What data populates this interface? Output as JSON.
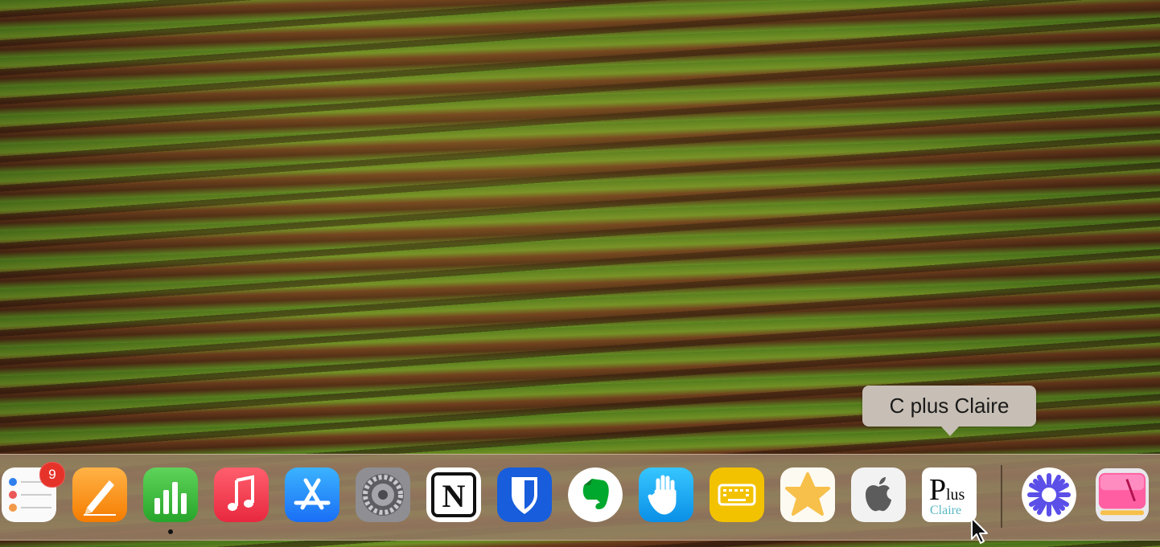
{
  "tooltip": {
    "text": "C plus Claire"
  },
  "dock": {
    "items": [
      {
        "name": "Reminders",
        "icon": "reminders-icon",
        "badge": "9"
      },
      {
        "name": "Pages",
        "icon": "pages-icon"
      },
      {
        "name": "Numbers",
        "icon": "numbers-icon",
        "running": true
      },
      {
        "name": "Music",
        "icon": "music-icon"
      },
      {
        "name": "App Store",
        "icon": "app-store-icon"
      },
      {
        "name": "System Settings",
        "icon": "gear-icon"
      },
      {
        "name": "Notion",
        "icon": "notion-icon",
        "glyph": "N"
      },
      {
        "name": "Bitwarden",
        "icon": "bitwarden-icon"
      },
      {
        "name": "Evernote",
        "icon": "evernote-icon"
      },
      {
        "name": "Hand app",
        "icon": "hand-icon"
      },
      {
        "name": "Keyboard app",
        "icon": "keyboard-icon"
      },
      {
        "name": "Star app",
        "icon": "star-icon"
      },
      {
        "name": "Apple Support",
        "icon": "apple-icon"
      },
      {
        "name": "C plus Claire",
        "icon": "plus-claire-icon",
        "glyph_main": "P",
        "glyph_sub": "lus",
        "glyph_word": "Claire"
      },
      {
        "name": "Perplexity",
        "icon": "asterisk-icon"
      },
      {
        "name": "CleanMyMac",
        "icon": "cleanmymac-icon"
      }
    ]
  },
  "colors": {
    "badge": "#e6332a",
    "dock_bg": "#967d64",
    "tooltip_bg": "#c7bfb5"
  }
}
